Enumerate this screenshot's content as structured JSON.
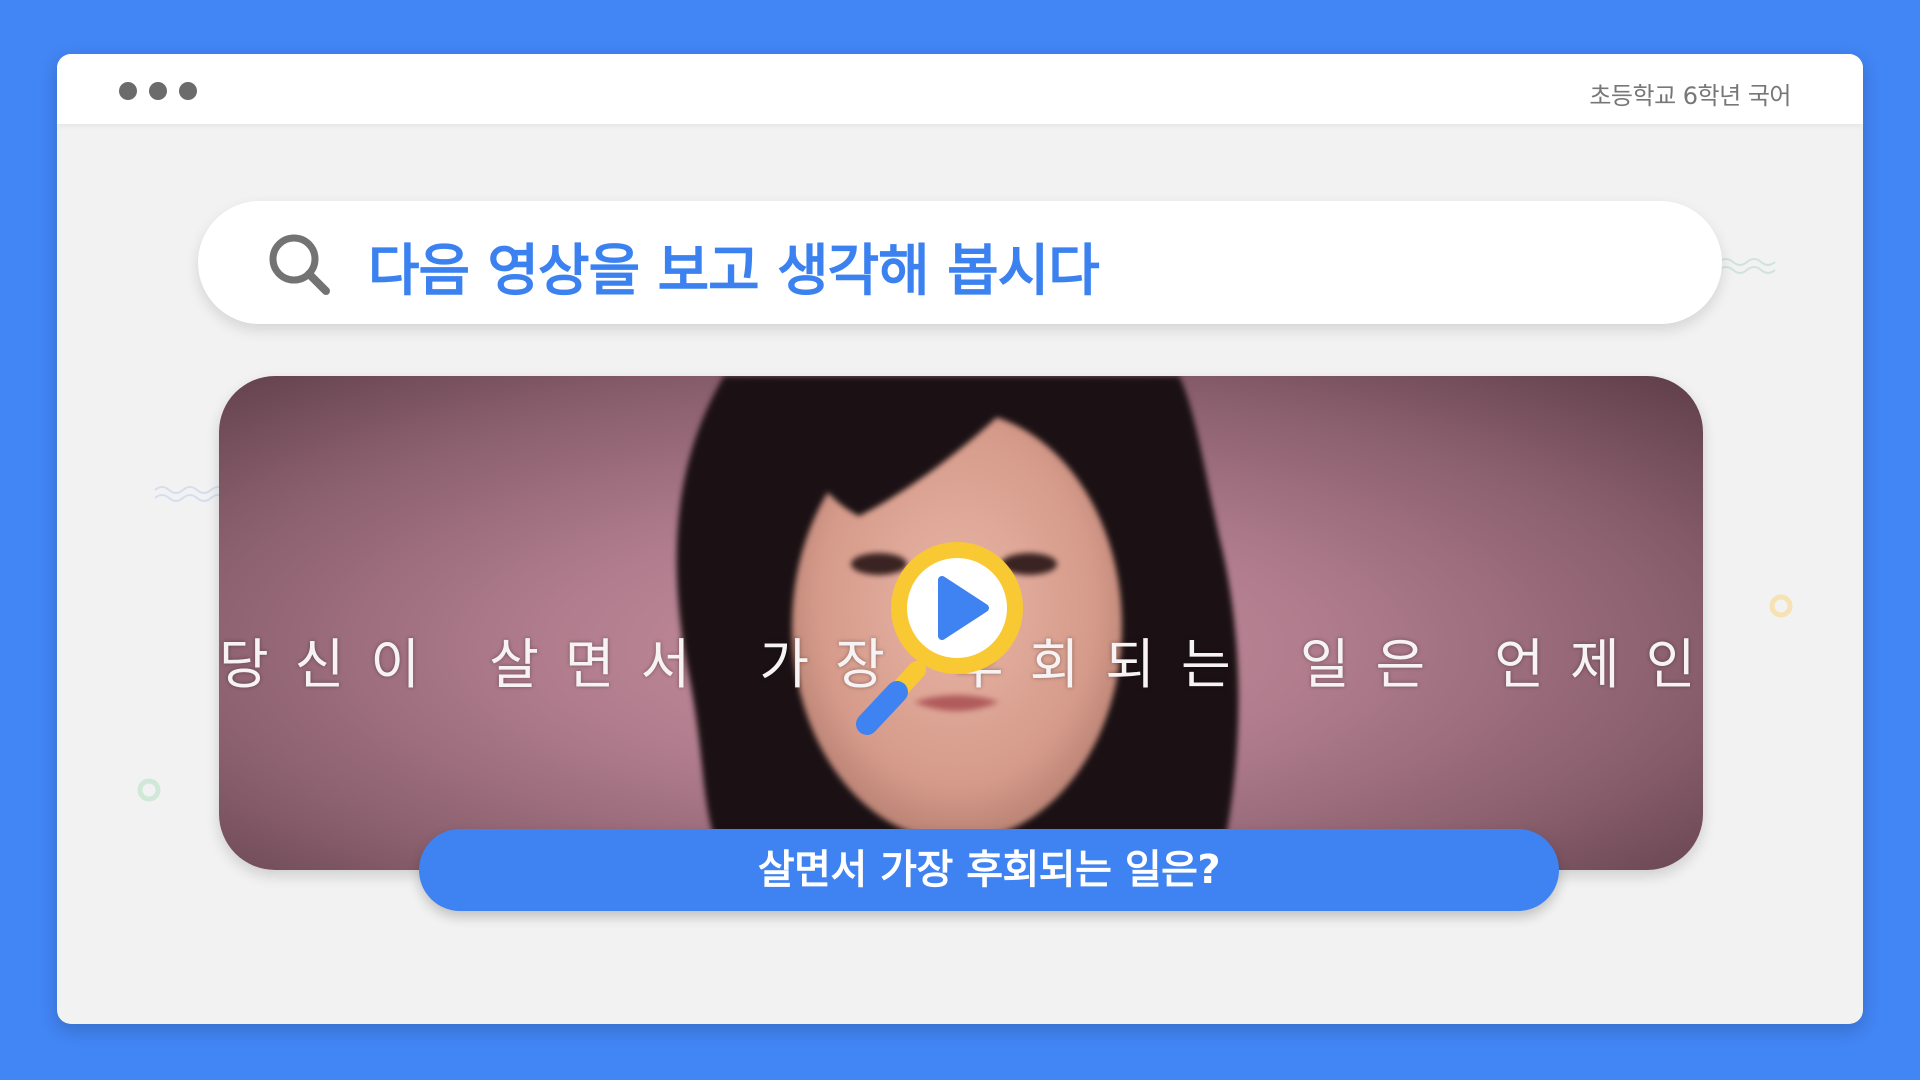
{
  "window": {
    "subject_label": "초등학교 6학년 국어"
  },
  "search": {
    "title": "다음 영상을 보고 생각해 봅시다"
  },
  "video": {
    "caption": "당신이 살면서 가장 후회되는 일은 언제인가요?",
    "play_icon": "play-icon"
  },
  "banner": {
    "text": "살면서 가장 후회되는 일은?"
  },
  "colors": {
    "background": "#4285f4",
    "accent_blue": "#3b82f0",
    "play_yellow": "#f9c933",
    "window_bg": "#f2f2f2"
  }
}
